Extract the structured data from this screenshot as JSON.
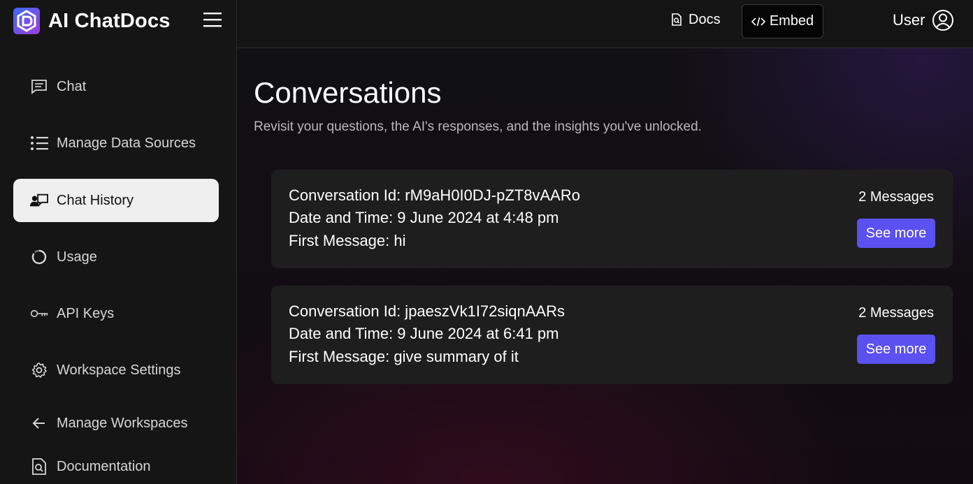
{
  "brand": {
    "name": "AI ChatDocs"
  },
  "sidebar": {
    "items": [
      {
        "label": "Chat",
        "icon": "chat-icon"
      },
      {
        "label": "Manage Data Sources",
        "icon": "list-icon"
      },
      {
        "label": "Chat History",
        "icon": "chat-history-icon",
        "active": true
      },
      {
        "label": "Usage",
        "icon": "usage-icon"
      },
      {
        "label": "API Keys",
        "icon": "key-icon"
      },
      {
        "label": "Workspace Settings",
        "icon": "gear-icon"
      },
      {
        "label": "Manage Workspaces",
        "icon": "arrow-left-icon"
      },
      {
        "label": "Documentation",
        "icon": "document-icon"
      }
    ]
  },
  "header": {
    "docs_label": "Docs",
    "embed_label": "Embed",
    "user_label": "User"
  },
  "main": {
    "title": "Conversations",
    "subtitle": "Revisit your questions, the AI's responses, and the insights you've unlocked.",
    "conversations": [
      {
        "id_line": "Conversation Id: rM9aH0I0DJ-pZT8vAARo",
        "datetime_line": "Date and Time: 9 June 2024 at 4:48 pm",
        "first_message_line": "First Message: hi",
        "count": "2 Messages",
        "button_label": "See more"
      },
      {
        "id_line": "Conversation Id: jpaeszVk1I72siqnAARs",
        "datetime_line": "Date and Time: 9 June 2024 at 6:41 pm",
        "first_message_line": "First Message: give summary of it",
        "count": "2 Messages",
        "button_label": "See more"
      }
    ]
  },
  "colors": {
    "accent": "#5b50f0",
    "sidebar_bg": "#151515",
    "card_bg": "#1e1e1e",
    "active_item_bg": "#efefef"
  }
}
